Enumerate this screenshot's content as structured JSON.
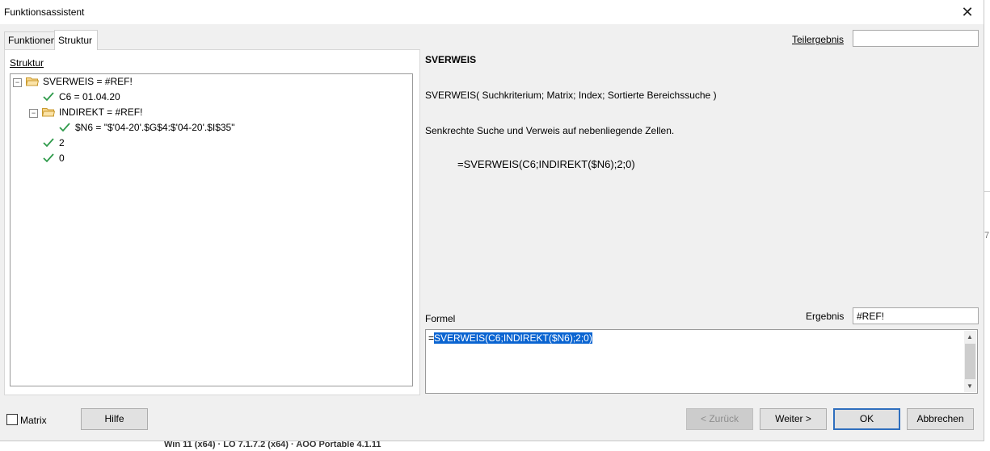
{
  "window": {
    "title": "Funktionsassistent"
  },
  "tabs": [
    {
      "label": "Funktionen"
    },
    {
      "label": "Struktur"
    }
  ],
  "structure": {
    "label": "Struktur",
    "tree": [
      {
        "text": "SVERWEIS = #REF!"
      },
      {
        "text": "C6 = 01.04.20"
      },
      {
        "text": "INDIREKT = #REF!"
      },
      {
        "text": "$N6 = \"$'04-20'.$G$4:$'04-20'.$I$35\""
      },
      {
        "text": "2"
      },
      {
        "text": "0"
      }
    ]
  },
  "teilergebnis": {
    "label": "Teilergebnis",
    "value": ""
  },
  "function_info": {
    "name": "SVERWEIS",
    "syntax": "SVERWEIS( Suchkriterium; Matrix; Index; Sortierte Bereichssuche )",
    "description": "Senkrechte Suche und Verweis auf nebenliegende Zellen.",
    "formula_preview": "=SVERWEIS(C6;INDIREKT($N6);2;0)"
  },
  "formel": {
    "label": "Formel",
    "prefix": "=",
    "selected": "SVERWEIS(C6;INDIREKT($N6);2;0)"
  },
  "ergebnis": {
    "label": "Ergebnis",
    "value": "#REF!"
  },
  "footer": {
    "matrix_label": "Matrix",
    "hilfe": "Hilfe",
    "zurueck": "< Zurück",
    "weiter": "Weiter >",
    "ok": "OK",
    "abbrechen": "Abbrechen"
  },
  "background": {
    "status": "Win 11 (x64) · LO 7.1.7.2 (x64) · AOO Portable 4.1.11",
    "edge_fragment": "7"
  }
}
